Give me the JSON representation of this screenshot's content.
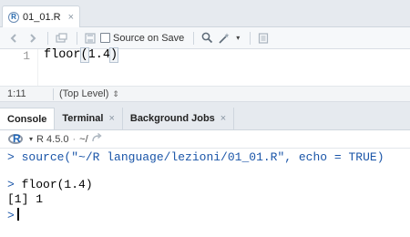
{
  "editor": {
    "tab": {
      "filename": "01_01.R",
      "icon": "r-file-icon",
      "close_icon": "close-icon"
    },
    "toolbar": {
      "source_on_save_label": "Source on Save",
      "source_on_save_checked": false,
      "icons": [
        "back-arrow-icon",
        "forward-arrow-icon",
        "show-in-window-icon",
        "save-icon",
        "search-icon",
        "magic-wand-icon",
        "chevron-down-icon",
        "compile-report-icon"
      ]
    },
    "lines": [
      {
        "number": "1",
        "code": "floor(1.4)"
      }
    ],
    "status": {
      "cursor_position": "1:11",
      "scope": "(Top Level)",
      "scope_icon": "updown-arrows-icon"
    }
  },
  "console": {
    "tabs": [
      {
        "label": "Console",
        "active": true,
        "closable": false
      },
      {
        "label": "Terminal",
        "active": false,
        "closable": true
      },
      {
        "label": "Background Jobs",
        "active": false,
        "closable": true
      }
    ],
    "toolbar": {
      "r_version": "R 4.5.0",
      "separator": "·",
      "working_dir": "~/",
      "goto_icon": "go-to-directory-icon"
    },
    "output": [
      {
        "prompt": ">",
        "text": "source(\"~/R language/lezioni/01_01.R\", echo = TRUE)"
      },
      {
        "prompt": ">",
        "text": "floor(1.4)"
      },
      {
        "result": "[1] 1"
      },
      {
        "prompt": ">",
        "text": ""
      }
    ],
    "colors": {
      "prompt": "#1a55a8",
      "output": "#000000"
    }
  }
}
